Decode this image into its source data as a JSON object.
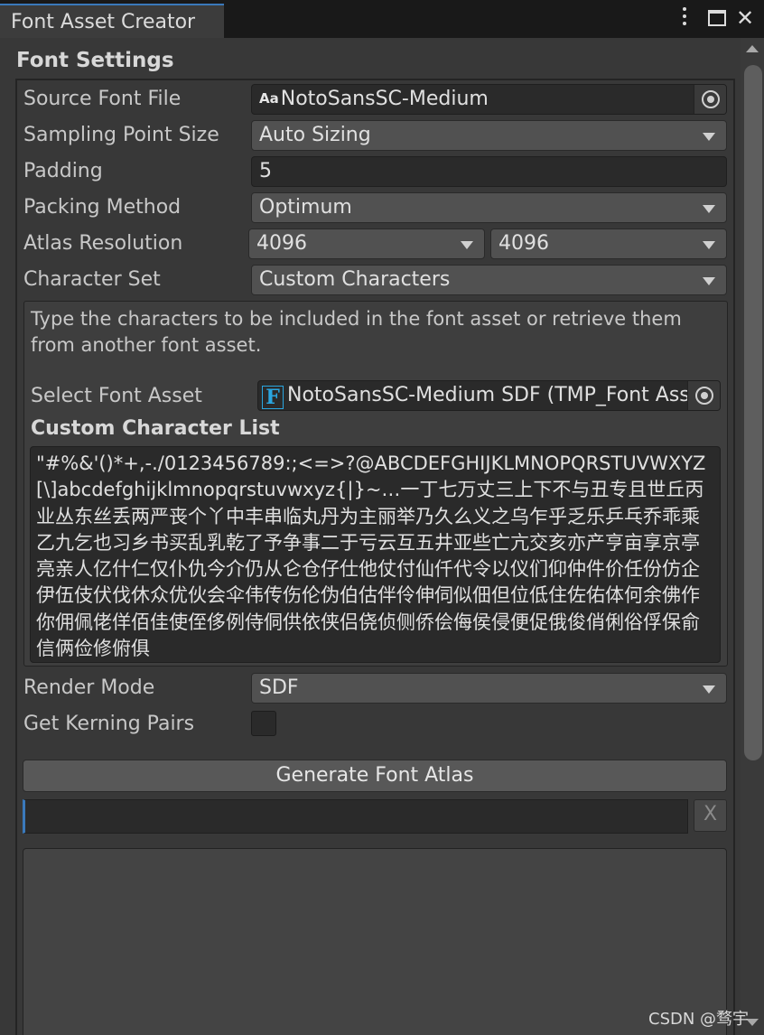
{
  "window": {
    "tab_title": "Font Asset Creator"
  },
  "settings": {
    "section_title": "Font Settings",
    "source_font_file": {
      "label": "Source Font File",
      "icon": "Aa",
      "value": "NotoSansSC-Medium"
    },
    "sampling_point_size": {
      "label": "Sampling Point Size",
      "value": "Auto Sizing"
    },
    "padding": {
      "label": "Padding",
      "value": "5"
    },
    "packing_method": {
      "label": "Packing Method",
      "value": "Optimum"
    },
    "atlas_resolution": {
      "label": "Atlas Resolution",
      "width": "4096",
      "height": "4096"
    },
    "character_set": {
      "label": "Character Set",
      "value": "Custom Characters"
    },
    "help_text": "Type the characters to be included in the font asset or retrieve them from another font asset.",
    "select_font_asset": {
      "label": "Select Font Asset",
      "icon": "F",
      "value": "NotoSansSC-Medium SDF (TMP_Font Asset)"
    },
    "custom_character_list": {
      "label": "Custom Character List",
      "value": "\"#%&'()*+,-./0123456789:;<=>?@ABCDEFGHIJKLMNOPQRSTUVWXYZ[\\]abcdefghijklmnopqrstuvwxyz{|}~…一丁七万丈三上下不与丑专且世丘丙业丛东丝丢两严丧个丫中丰串临丸丹为主丽举乃久么义之乌乍乎乏乐乒乓乔乖乘乙九乞也习乡书买乱乳乾了予争事二于亏云互五井亚些亡亢交亥亦产亨亩享京亭亮亲人亿什仁仅仆仇今介仍从仑仓仔仕他仗付仙仟代令以仪们仰仲件价任份仿企伊伍伎伏伐休众优伙会伞伟传伤伦伪伯估伴伶伸伺似佃但位低住佐佑体何余佛作你佣佩佬佯佰佳使侄侈例侍侗供依侠侣侥侦侧侨侩侮侯侵便促俄俊俏俐俗俘保俞信俩俭修俯俱"
    },
    "render_mode": {
      "label": "Render Mode",
      "value": "SDF"
    },
    "get_kerning_pairs": {
      "label": "Get Kerning Pairs",
      "checked": false
    }
  },
  "actions": {
    "generate_label": "Generate Font Atlas",
    "cancel_label": "X"
  },
  "watermark": "CSDN @骛宇"
}
